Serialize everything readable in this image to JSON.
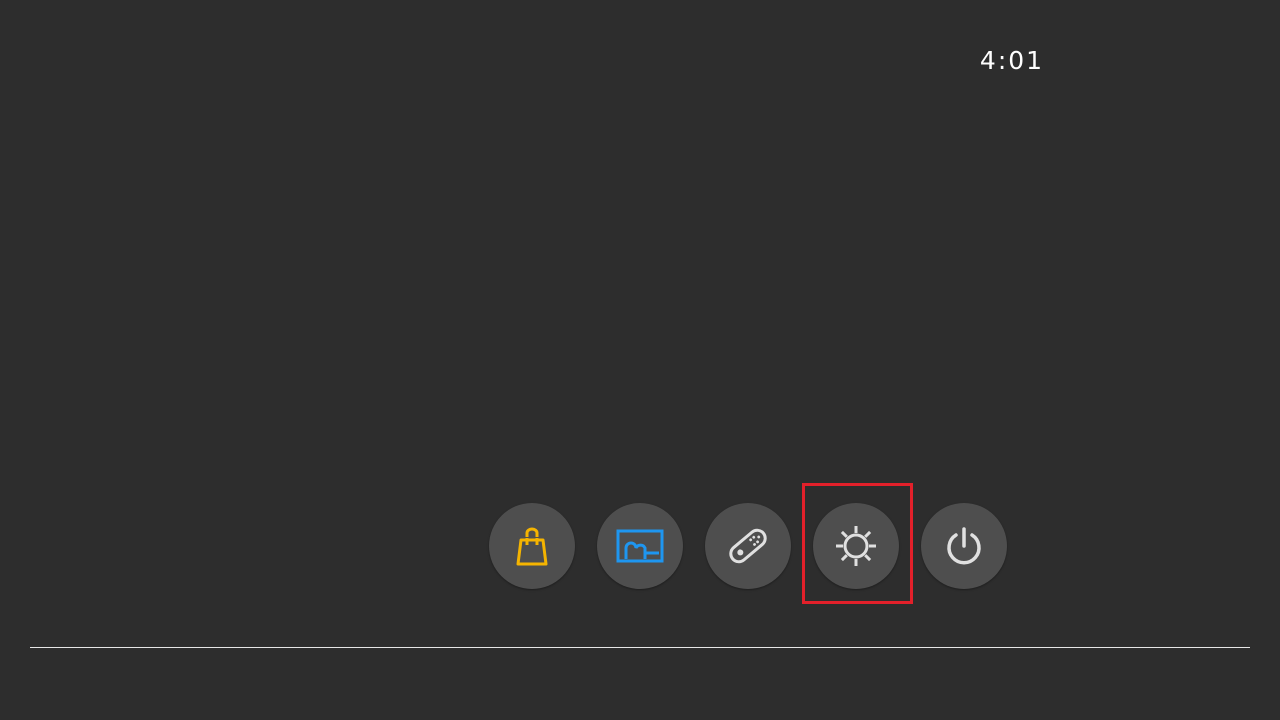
{
  "status_bar": {
    "clock": "4:01"
  },
  "dock": {
    "buttons": [
      {
        "name": "shop",
        "icon": "shopping-bag-icon",
        "color": "#f5b400"
      },
      {
        "name": "album",
        "icon": "album-icon",
        "color": "#1e96f0"
      },
      {
        "name": "controllers",
        "icon": "controller-icon",
        "color": "#e0e0e0"
      },
      {
        "name": "system-settings",
        "icon": "gear-icon",
        "color": "#e0e0e0",
        "selected": true
      },
      {
        "name": "power",
        "icon": "power-icon",
        "color": "#e0e0e0"
      }
    ]
  },
  "theme": {
    "background": "#2d2d2d",
    "button_background": "#4e4e4e",
    "selection_color": "#e3202a",
    "divider_color": "#e6e6e6"
  }
}
